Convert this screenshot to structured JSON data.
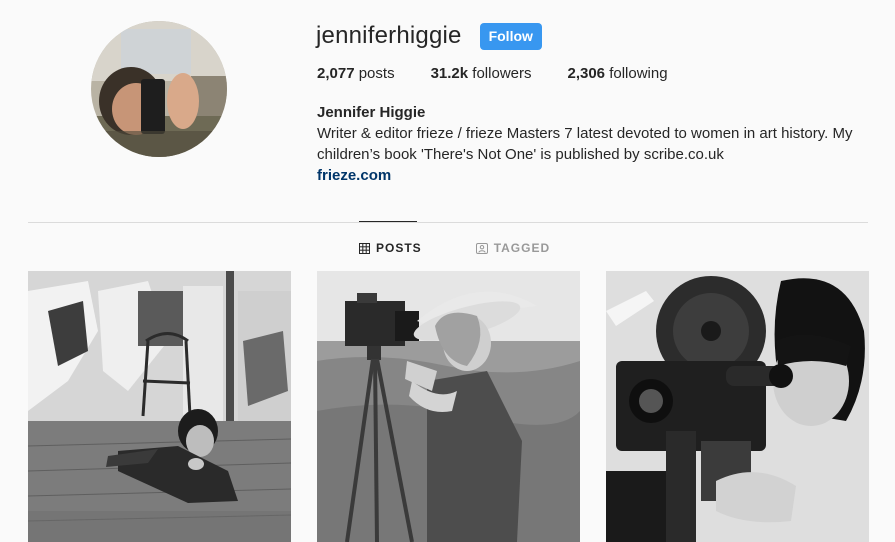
{
  "profile": {
    "username": "jenniferhiggie",
    "follow_label": "Follow",
    "stats": [
      {
        "count": "2,077",
        "label": "posts"
      },
      {
        "count": "31.2k",
        "label": "followers"
      },
      {
        "count": "2,306",
        "label": "following"
      }
    ],
    "full_name": "Jennifer Higgie",
    "bio_line1": "Writer & editor frieze / frieze Masters 7 latest devoted to women in art history. My",
    "bio_line2": "children’s book 'There's Not One' is published by scribe.co.uk",
    "website": "frieze.com"
  },
  "tabs": [
    {
      "label": "POSTS",
      "icon": "grid-icon",
      "active": true
    },
    {
      "label": "TAGGED",
      "icon": "tag-icon",
      "active": false
    }
  ],
  "colors": {
    "follow_button": "#3897f0",
    "link": "#003569",
    "background": "#fafafa"
  }
}
